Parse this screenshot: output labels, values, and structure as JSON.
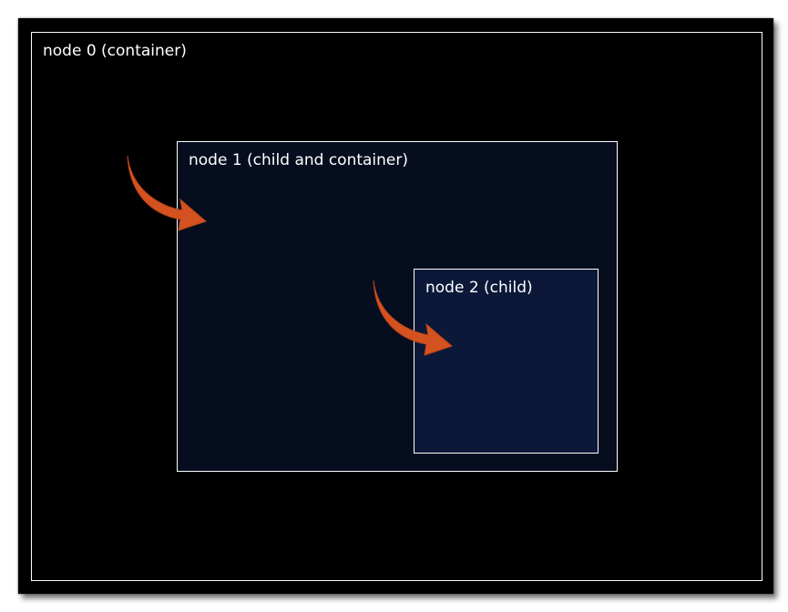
{
  "nodes": [
    {
      "label": "node 0 (container)"
    },
    {
      "label": "node 1 (child and container)"
    },
    {
      "label": "node 2 (child)"
    }
  ],
  "colors": {
    "background": "#000000",
    "node0_fill": "#000000",
    "node1_fill": "#060d1f",
    "node2_fill": "#0b1838",
    "border": "#ffffff",
    "arrow": "#d4521f"
  }
}
